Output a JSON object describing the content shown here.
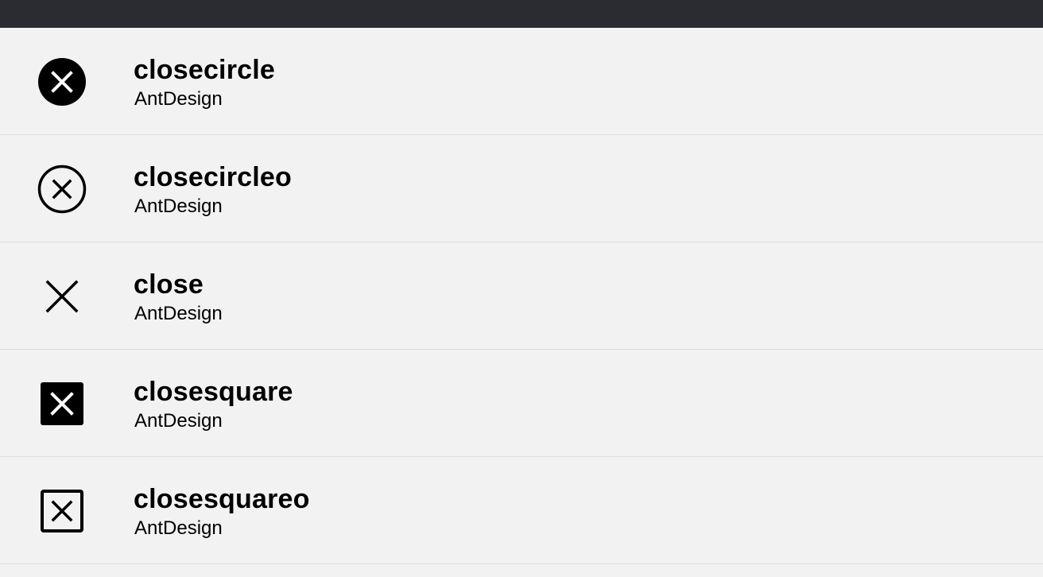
{
  "icons": [
    {
      "name": "closecircle",
      "family": "AntDesign",
      "glyph": "close-circle-filled-icon"
    },
    {
      "name": "closecircleo",
      "family": "AntDesign",
      "glyph": "close-circle-outline-icon"
    },
    {
      "name": "close",
      "family": "AntDesign",
      "glyph": "close-icon"
    },
    {
      "name": "closesquare",
      "family": "AntDesign",
      "glyph": "close-square-filled-icon"
    },
    {
      "name": "closesquareo",
      "family": "AntDesign",
      "glyph": "close-square-outline-icon"
    }
  ],
  "colors": {
    "topbar": "#2b2c31",
    "background": "#f2f2f2",
    "divider": "#dcdcdc",
    "text": "#000000"
  }
}
